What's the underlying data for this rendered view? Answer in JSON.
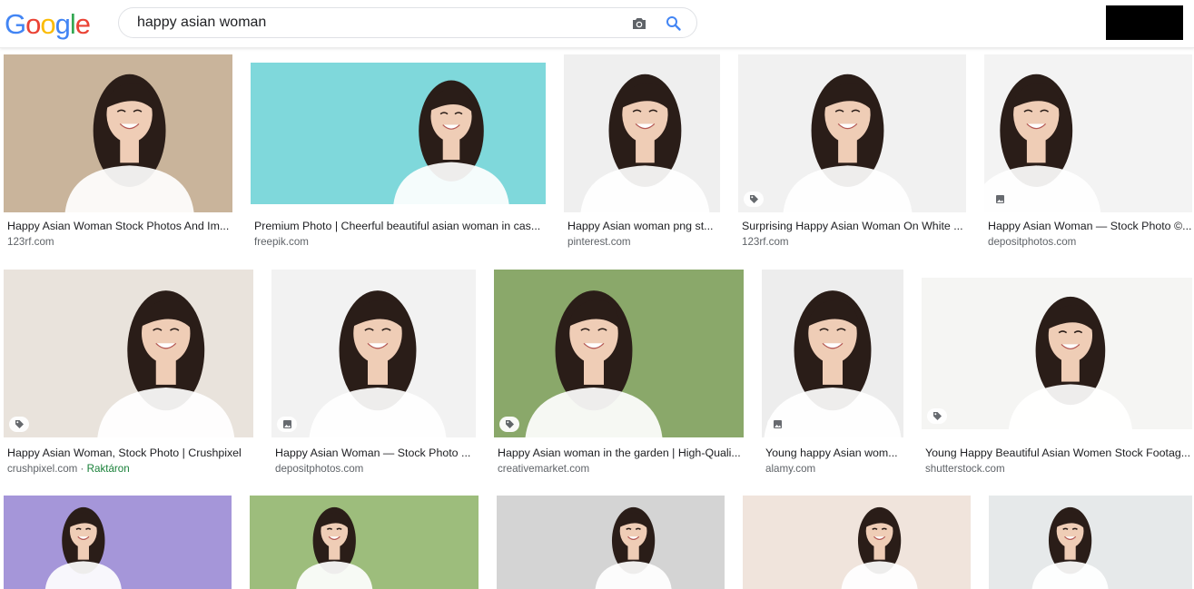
{
  "logo": [
    "G",
    "o",
    "o",
    "g",
    "l",
    "e"
  ],
  "logo_colors": [
    "#4285F4",
    "#EA4335",
    "#FBBC05",
    "#4285F4",
    "#34A853",
    "#EA4335"
  ],
  "search": {
    "value": "happy asian woman"
  },
  "icons": {
    "camera": "camera-icon",
    "search": "search-icon",
    "tag": "tag-icon",
    "image": "image-icon"
  },
  "results": [
    {
      "title": "Happy Asian Woman Stock Photos And Im...",
      "source": "123rf.com",
      "badge": ""
    },
    {
      "title": "Premium Photo | Cheerful beautiful asian woman in cas...",
      "source": "freepik.com",
      "badge": ""
    },
    {
      "title": "Happy Asian woman png st...",
      "source": "pinterest.com",
      "badge": ""
    },
    {
      "title": "Surprising Happy Asian Woman On White ...",
      "source": "123rf.com",
      "badge": "tag"
    },
    {
      "title": "Happy Asian Woman — Stock Photo ©...",
      "source": "depositphotos.com",
      "badge": "image"
    },
    {
      "title": "Happy Asian Woman, Stock Photo | Crushpixel",
      "source": "crushpixel.com",
      "stock": "Raktáron",
      "badge": "tag"
    },
    {
      "title": "Happy Asian Woman — Stock Photo ...",
      "source": "depositphotos.com",
      "badge": "image"
    },
    {
      "title": "Happy Asian woman in the garden | High-Quali...",
      "source": "creativemarket.com",
      "badge": "tag"
    },
    {
      "title": "Young happy Asian wom...",
      "source": "alamy.com",
      "badge": "image"
    },
    {
      "title": "Young Happy Beautiful Asian Women Stock Footag...",
      "source": "shutterstock.com",
      "badge": "tag"
    },
    {
      "title": "",
      "source": "",
      "badge": ""
    },
    {
      "title": "",
      "source": "",
      "badge": ""
    },
    {
      "title": "",
      "source": "",
      "badge": ""
    },
    {
      "title": "",
      "source": "",
      "badge": ""
    },
    {
      "title": "",
      "source": "",
      "badge": ""
    }
  ],
  "colors": {
    "tile_bg": [
      "#c9b49b",
      "#7fd8db",
      "#efefef",
      "#f1f1f1",
      "#f3f3f3",
      "#e9e3dc",
      "#f2f2f2",
      "#8aa86a",
      "#ededed",
      "#f5f5f3",
      "#a596d9",
      "#9dbd7c",
      "#d4d4d4",
      "#f0e4dc",
      "#e6e9ea"
    ],
    "hair": "#2a1d18",
    "skin": "#efcdb6"
  }
}
